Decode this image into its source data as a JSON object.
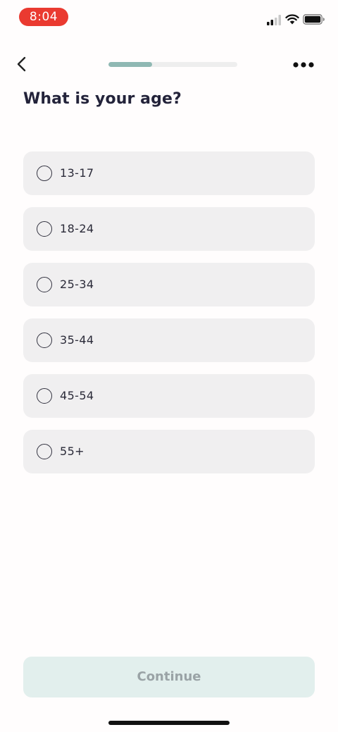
{
  "status_bar": {
    "time": "8:04",
    "time_pill_color": "#ea3a30",
    "icons": [
      "cellular-signal-icon",
      "wifi-icon",
      "battery-icon"
    ]
  },
  "header": {
    "back_icon": "chevron-left-icon",
    "progress_fraction": 0.34,
    "progress_color": "#8fb8b3",
    "more_icon": "ellipsis-icon"
  },
  "question": {
    "title": "What is your age?"
  },
  "options": [
    {
      "label": "13-17",
      "selected": false
    },
    {
      "label": "18-24",
      "selected": false
    },
    {
      "label": "25-34",
      "selected": false
    },
    {
      "label": "35-44",
      "selected": false
    },
    {
      "label": "45-54",
      "selected": false
    },
    {
      "label": "55+",
      "selected": false
    }
  ],
  "footer": {
    "continue_label": "Continue",
    "continue_enabled": false
  }
}
